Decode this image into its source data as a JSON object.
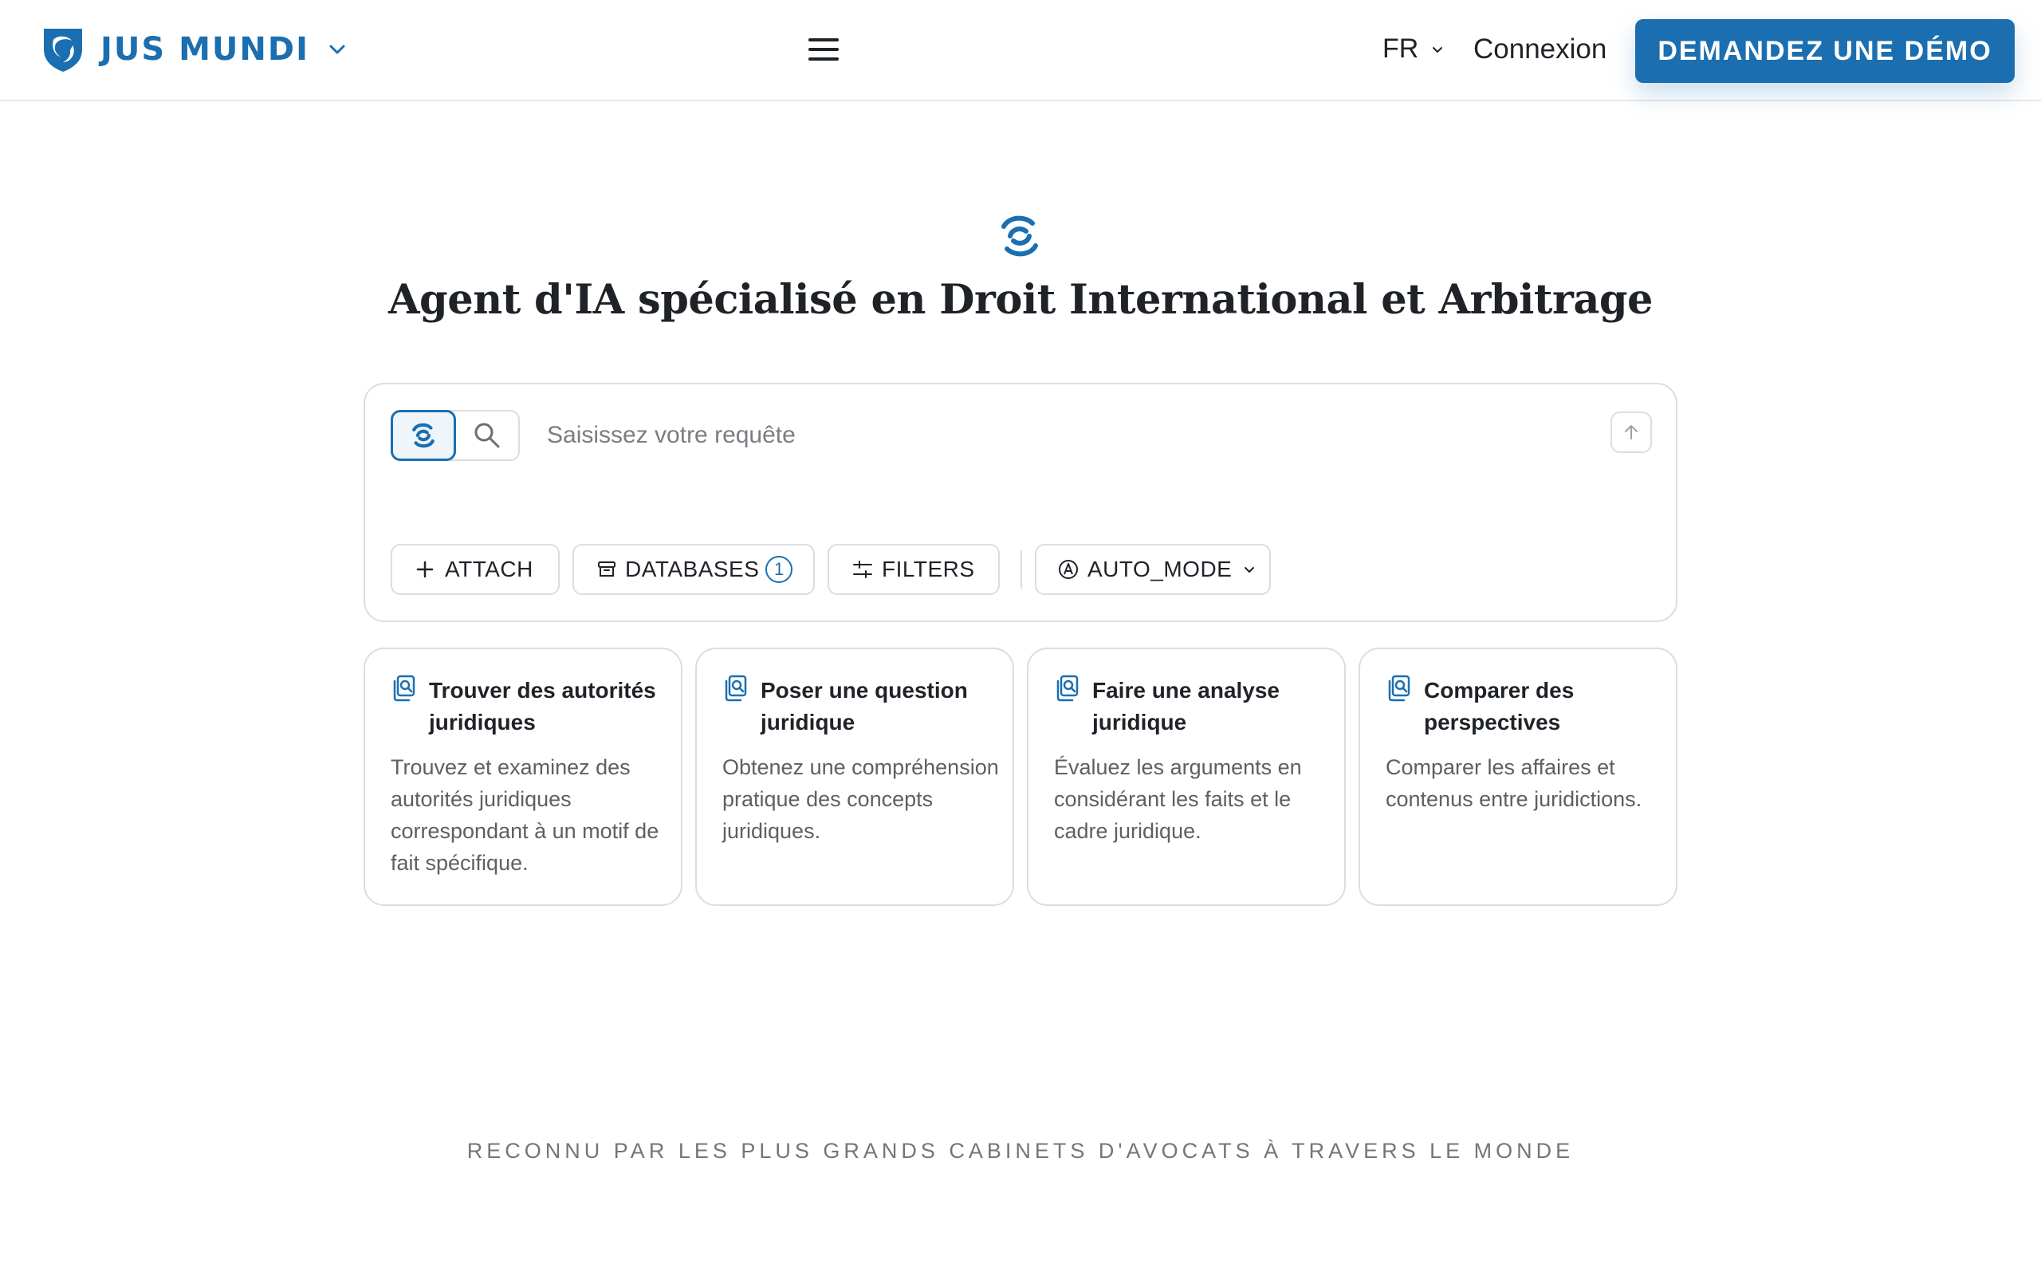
{
  "header": {
    "brand": "JUS MUNDI",
    "language": "FR",
    "login_label": "Connexion",
    "demo_label": "DEMANDEZ UNE DÉMO",
    "brand_color": "#1b6fb0"
  },
  "hero": {
    "title": "Agent d'IA spécialisé en Droit International et Arbitrage",
    "icon": "ai-swirl-icon"
  },
  "query": {
    "placeholder": "Saisissez votre requête",
    "value": "",
    "modes": [
      "ai-swirl-icon",
      "search-icon"
    ],
    "active_mode": "ai-swirl-icon",
    "attach_label": "ATTACH",
    "databases_label": "DATABASES",
    "databases_count": "1",
    "filters_label": "FILTERS",
    "auto_mode_label": "AUTO_MODE"
  },
  "cards": [
    {
      "title": "Trouver des autorités juridiques",
      "description": "Trouvez et examinez des autorités juridiques correspondant à un motif de fait spécifique.",
      "icon": "documents-search-icon"
    },
    {
      "title": "Poser une question juridique",
      "description": "Obtenez une compréhension pratique des concepts juridiques.",
      "icon": "documents-search-icon"
    },
    {
      "title": "Faire une analyse juridique",
      "description": "Évaluez les arguments en considérant les faits et le cadre juridique.",
      "icon": "documents-search-icon"
    },
    {
      "title": "Comparer des perspectives",
      "description": "Comparer les affaires et contenus entre juridictions.",
      "icon": "documents-search-icon"
    }
  ],
  "tagline": "RECONNU PAR LES PLUS GRANDS CABINETS D'AVOCATS À TRAVERS LE MONDE"
}
